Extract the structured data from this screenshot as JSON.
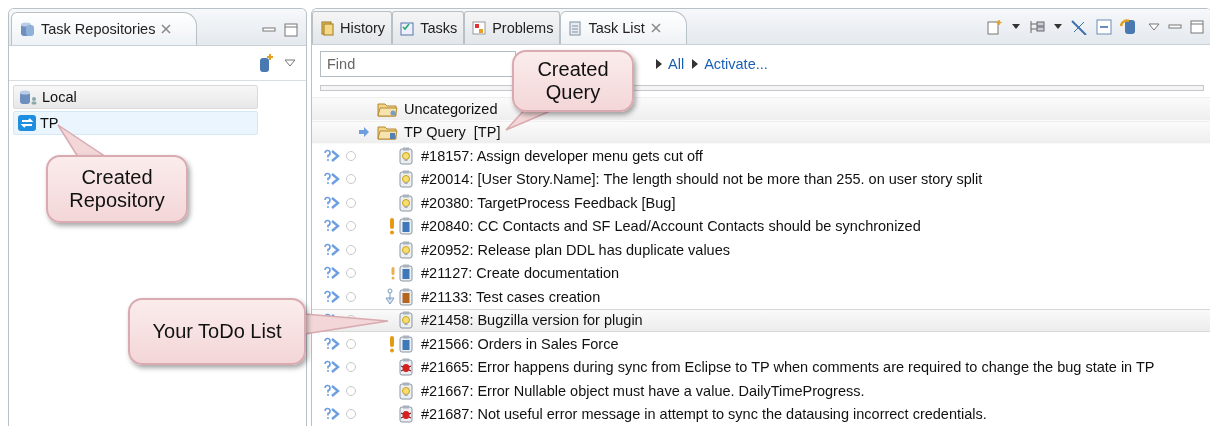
{
  "repositories_view": {
    "title": "Task Repositories",
    "repositories": [
      {
        "label": "Local",
        "kind": "local",
        "selected": false
      },
      {
        "label": "TP",
        "kind": "remote",
        "selected": true
      }
    ]
  },
  "task_list_view": {
    "tabs": [
      {
        "label": "History",
        "kind": "history",
        "selected": false
      },
      {
        "label": "Tasks",
        "kind": "tasks",
        "selected": false
      },
      {
        "label": "Problems",
        "kind": "problems",
        "selected": false
      },
      {
        "label": "Task List",
        "kind": "tasklist",
        "selected": true
      }
    ],
    "find": {
      "placeholder": "Find"
    },
    "links": [
      "All",
      "Activate..."
    ],
    "categories": [
      {
        "label": "Uncategorized",
        "kind": "category",
        "active": false
      },
      {
        "label": "TP Query  [TP]",
        "kind": "query",
        "active": true
      }
    ],
    "tasks": [
      {
        "text": "#18157: Assign developer menu gets cut off",
        "kind": "request",
        "selected": false
      },
      {
        "text": "#20014: [User Story.Name]: The length should not be more than 255. on user story split",
        "kind": "request",
        "selected": false
      },
      {
        "text": "#20380: TargetProcess Feedback [Bug]",
        "kind": "request",
        "selected": false
      },
      {
        "text": "#20840: CC Contacts and SF Lead/Account Contacts should be synchronized",
        "kind": "story",
        "priority": {
          "kind": "high"
        },
        "selected": false
      },
      {
        "text": "#20952: Release plan DDL has duplicate values",
        "kind": "request",
        "selected": false
      },
      {
        "text": "#21127: Create documentation",
        "kind": "story",
        "priority": {
          "kind": "medium"
        },
        "selected": false
      },
      {
        "text": "#21133: Test cases creation",
        "kind": "task",
        "priority": {
          "kind": "low"
        },
        "selected": false
      },
      {
        "text": "#21458: Bugzilla version for plugin",
        "kind": "request",
        "selected": true
      },
      {
        "text": "#21566: Orders in Sales Force",
        "kind": "story",
        "priority": {
          "kind": "high"
        },
        "selected": false
      },
      {
        "text": "#21665: Error happens during sync from Eclipse to TP when comments are required to change the bug state in TP",
        "kind": "bug",
        "selected": false
      },
      {
        "text": "#21667: Error Nullable object must have a value. DailyTimeProgress.",
        "kind": "request",
        "selected": false
      },
      {
        "text": "#21687: Not useful error message in attempt to sync the datausing incorrect credentials.",
        "kind": "bug",
        "selected": false
      }
    ]
  },
  "callouts": [
    {
      "text": "Created Query",
      "kind": "query"
    },
    {
      "text": "Created Repository",
      "kind": "repository"
    },
    {
      "text": "Your ToDo List",
      "kind": "todo"
    }
  ]
}
